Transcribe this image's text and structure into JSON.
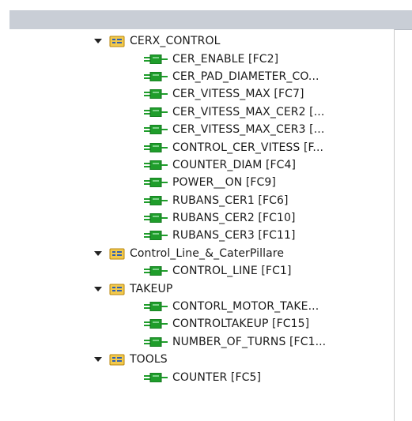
{
  "tree": {
    "groups": [
      {
        "name": "CERX_CONTROL",
        "expanded": true,
        "icon": "folder-group-icon",
        "items": [
          {
            "label": "CER_ENABLE [FC2]",
            "icon": "function-block-icon"
          },
          {
            "label": "CER_PAD_DIAMETER_CO...",
            "icon": "function-block-icon"
          },
          {
            "label": "CER_VITESS_MAX [FC7]",
            "icon": "function-block-icon"
          },
          {
            "label": "CER_VITESS_MAX_CER2 [...",
            "icon": "function-block-icon"
          },
          {
            "label": "CER_VITESS_MAX_CER3 [...",
            "icon": "function-block-icon"
          },
          {
            "label": "CONTROL_CER_VITESS [F...",
            "icon": "function-block-icon"
          },
          {
            "label": "COUNTER_DIAM [FC4]",
            "icon": "function-block-icon"
          },
          {
            "label": "POWER__ON [FC9]",
            "icon": "function-block-icon"
          },
          {
            "label": "RUBANS_CER1 [FC6]",
            "icon": "function-block-icon"
          },
          {
            "label": "RUBANS_CER2 [FC10]",
            "icon": "function-block-icon"
          },
          {
            "label": "RUBANS_CER3 [FC11]",
            "icon": "function-block-icon"
          }
        ]
      },
      {
        "name": "Control_Line_&_CaterPillare",
        "expanded": true,
        "icon": "folder-group-icon",
        "items": [
          {
            "label": "CONTROL_LINE [FC1]",
            "icon": "function-block-icon"
          }
        ]
      },
      {
        "name": "TAKEUP",
        "expanded": true,
        "icon": "folder-group-icon",
        "items": [
          {
            "label": "CONTORL_MOTOR_TAKE...",
            "icon": "function-block-icon"
          },
          {
            "label": "CONTROLTAKEUP [FC15]",
            "icon": "function-block-icon"
          },
          {
            "label": "NUMBER_OF_TURNS [FC1...",
            "icon": "function-block-icon"
          }
        ]
      },
      {
        "name": "TOOLS",
        "expanded": true,
        "icon": "folder-group-icon",
        "items": [
          {
            "label": "COUNTER [FC5]",
            "icon": "function-block-icon"
          }
        ]
      }
    ]
  },
  "colors": {
    "header_bg": "#c9ced6",
    "folder_fill": "#f2c94c",
    "folder_border": "#b8860b",
    "block_green": "#1f9d2b",
    "block_dark": "#0f6b1a"
  }
}
